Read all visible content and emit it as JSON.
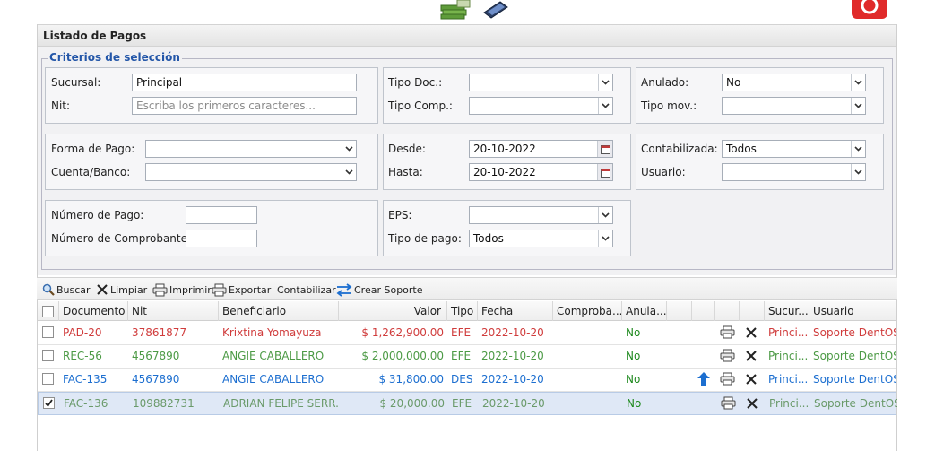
{
  "panel": {
    "title": "Listado de Pagos"
  },
  "criteria": {
    "legend": "Criterios de selección",
    "sucursal": {
      "label": "Sucursal:",
      "value": "Principal"
    },
    "nit": {
      "label": "Nit:",
      "placeholder": "Escriba los primeros caracteres..."
    },
    "tipo_doc": {
      "label": "Tipo Doc.:",
      "value": ""
    },
    "tipo_comp": {
      "label": "Tipo Comp.:",
      "value": ""
    },
    "anulado": {
      "label": "Anulado:",
      "value": "No"
    },
    "tipo_mov": {
      "label": "Tipo mov.:",
      "value": ""
    },
    "forma_pago": {
      "label": "Forma de Pago:",
      "value": ""
    },
    "cuenta_banco": {
      "label": "Cuenta/Banco:",
      "value": ""
    },
    "desde": {
      "label": "Desde:",
      "value": "20-10-2022"
    },
    "hasta": {
      "label": "Hasta:",
      "value": "20-10-2022"
    },
    "contabilizada": {
      "label": "Contabilizada:",
      "value": "Todos"
    },
    "usuario": {
      "label": "Usuario:",
      "value": ""
    },
    "numero_pago": {
      "label": "Número de Pago:",
      "value": ""
    },
    "numero_comprobante": {
      "label": "Número de Comprobante:",
      "value": ""
    },
    "eps": {
      "label": "EPS:",
      "value": ""
    },
    "tipo_pago": {
      "label": "Tipo de pago:",
      "value": "Todos"
    }
  },
  "toolbar": {
    "buscar": "Buscar",
    "limpiar": "Limpiar",
    "imprimir": "Imprimir",
    "exportar": "Exportar",
    "contabilizar": "Contabilizar",
    "crear_soporte": "Crear Soporte"
  },
  "grid": {
    "columns": [
      "Documento",
      "Nit",
      "Beneficiario",
      "Valor",
      "Tipo",
      "Fecha",
      "Comproba...",
      "Anula...",
      "Sucur...",
      "Usuario"
    ],
    "rows": [
      {
        "documento": "PAD-20",
        "nit": "37861877",
        "beneficiario": "Krixtina Yomayuza",
        "valor": "$ 1,262,900.00",
        "tipo": "EFE",
        "fecha": "2022-10-20",
        "anulado": "No",
        "sucursal": "Princi...",
        "usuario": "Soporte DentOS",
        "color": "#d03c3c",
        "checked": false,
        "upload": false,
        "selected": false
      },
      {
        "documento": "REC-56",
        "nit": "4567890",
        "beneficiario": "ANGIE CABALLERO",
        "valor": "$ 2,000,000.00",
        "tipo": "EFE",
        "fecha": "2022-10-20",
        "anulado": "No",
        "sucursal": "Princi...",
        "usuario": "Soporte DentOS",
        "color": "#4c9a45",
        "checked": false,
        "upload": false,
        "selected": false
      },
      {
        "documento": "FAC-135",
        "nit": "4567890",
        "beneficiario": "ANGIE CABALLERO",
        "valor": "$ 31,800.00",
        "tipo": "DES",
        "fecha": "2022-10-20",
        "anulado": "No",
        "sucursal": "Princi...",
        "usuario": "Soporte DentOS",
        "color": "#1d6fd0",
        "checked": false,
        "upload": true,
        "selected": false
      },
      {
        "documento": "FAC-136",
        "nit": "109882731",
        "beneficiario": "ADRIAN FELIPE SERR...",
        "valor": "$ 20,000.00",
        "tipo": "EFE",
        "fecha": "2022-10-20",
        "anulado": "No",
        "sucursal": "Princi...",
        "usuario": "Soporte DentOS",
        "color": "#6a9a6a",
        "checked": true,
        "upload": false,
        "selected": true
      }
    ]
  },
  "colors": {
    "accent": "#2356a8",
    "anulado_no": "#1f8a1f",
    "upload_arrow": "#1d6fd0",
    "close_app": "#e02a2a"
  }
}
